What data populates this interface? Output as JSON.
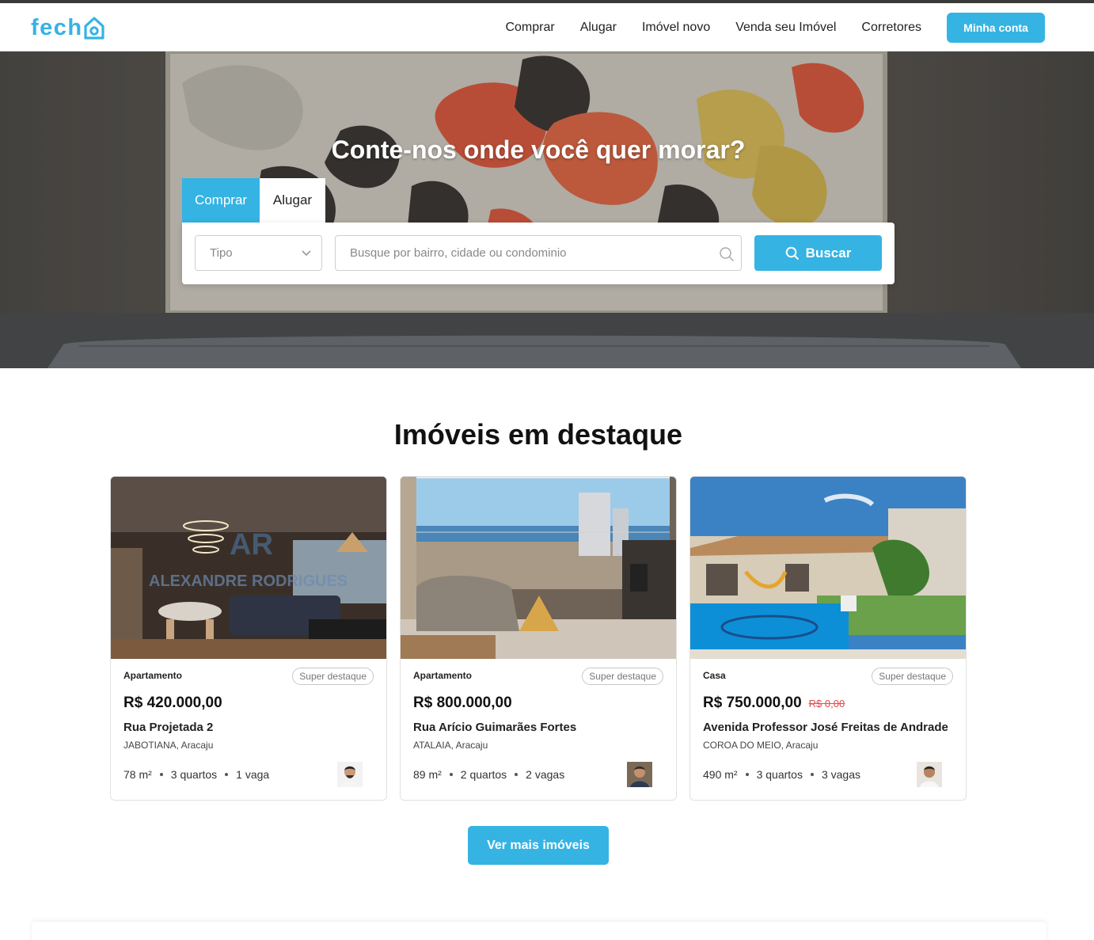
{
  "brand": {
    "logo_text": "fech",
    "accent_color": "#35b3e3",
    "icon": "house-o-icon"
  },
  "nav": {
    "items": [
      {
        "label": "Comprar"
      },
      {
        "label": "Alugar"
      },
      {
        "label": "Imóvel novo"
      },
      {
        "label": "Venda seu Imóvel"
      },
      {
        "label": "Corretores"
      }
    ],
    "account_label": "Minha conta"
  },
  "hero": {
    "title": "Conte-nos onde você quer morar?",
    "tabs": [
      {
        "label": "Comprar",
        "active": true
      },
      {
        "label": "Alugar",
        "active": false
      }
    ],
    "type_select": {
      "value": "Tipo",
      "icon": "chevron-down-icon"
    },
    "search": {
      "placeholder": "Busque por bairro, cidade ou condominio",
      "icon": "search-icon"
    },
    "search_button": "Buscar"
  },
  "featured": {
    "title": "Imóveis em destaque",
    "cards": [
      {
        "type": "Apartamento",
        "badge": "Super destaque",
        "price": "R$ 420.000,00",
        "old_price": "",
        "street": "Rua Projetada 2",
        "area": "JABOTIANA, Aracaju",
        "size": "78 m²",
        "rooms": "3 quartos",
        "parking": "1 vaga",
        "watermark": "ALEXANDRE RODRIGUES"
      },
      {
        "type": "Apartamento",
        "badge": "Super destaque",
        "price": "R$ 800.000,00",
        "old_price": "",
        "street": "Rua Arício Guimarães Fortes",
        "area": "ATALAIA, Aracaju",
        "size": "89 m²",
        "rooms": "2 quartos",
        "parking": "2 vagas"
      },
      {
        "type": "Casa",
        "badge": "Super destaque",
        "price": "R$ 750.000,00",
        "old_price": "R$ 0,00",
        "street": "Avenida Professor José Freitas de Andrade",
        "area": "COROA DO MEIO, Aracaju",
        "size": "490 m²",
        "rooms": "3 quartos",
        "parking": "3 vagas"
      }
    ],
    "more_button": "Ver mais imóveis"
  }
}
